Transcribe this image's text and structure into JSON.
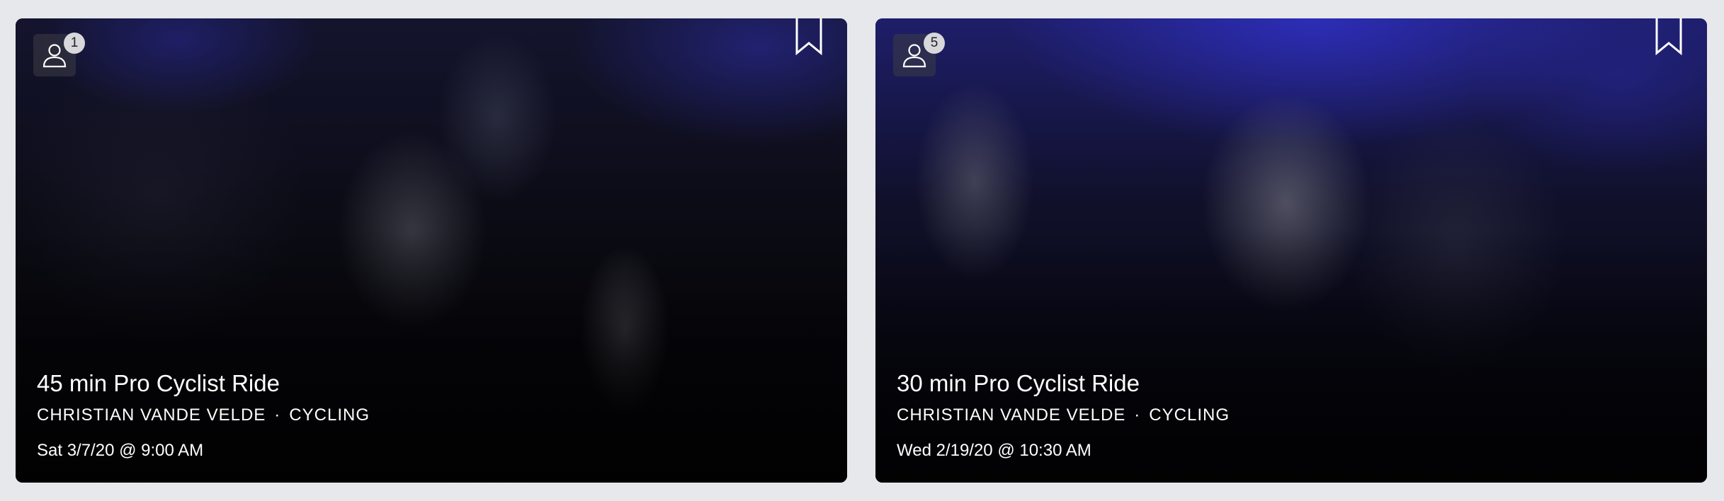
{
  "cards": [
    {
      "title": "45 min Pro Cyclist Ride",
      "instructor": "CHRISTIAN VANDE VELDE",
      "separator": "·",
      "category": "CYCLING",
      "datetime": "Sat 3/7/20 @ 9:00 AM",
      "user_count": "1",
      "icons": [
        "user-icon",
        "bookmark-icon"
      ]
    },
    {
      "title": "30 min Pro Cyclist Ride",
      "instructor": "CHRISTIAN VANDE VELDE",
      "separator": "·",
      "category": "CYCLING",
      "datetime": "Wed 2/19/20 @ 10:30 AM",
      "user_count": "5",
      "icons": [
        "user-icon",
        "bookmark-icon"
      ]
    }
  ],
  "colors": {
    "page_background": "#e6e8eb",
    "text": "#ffffff",
    "badge": "#d7d7dc"
  }
}
